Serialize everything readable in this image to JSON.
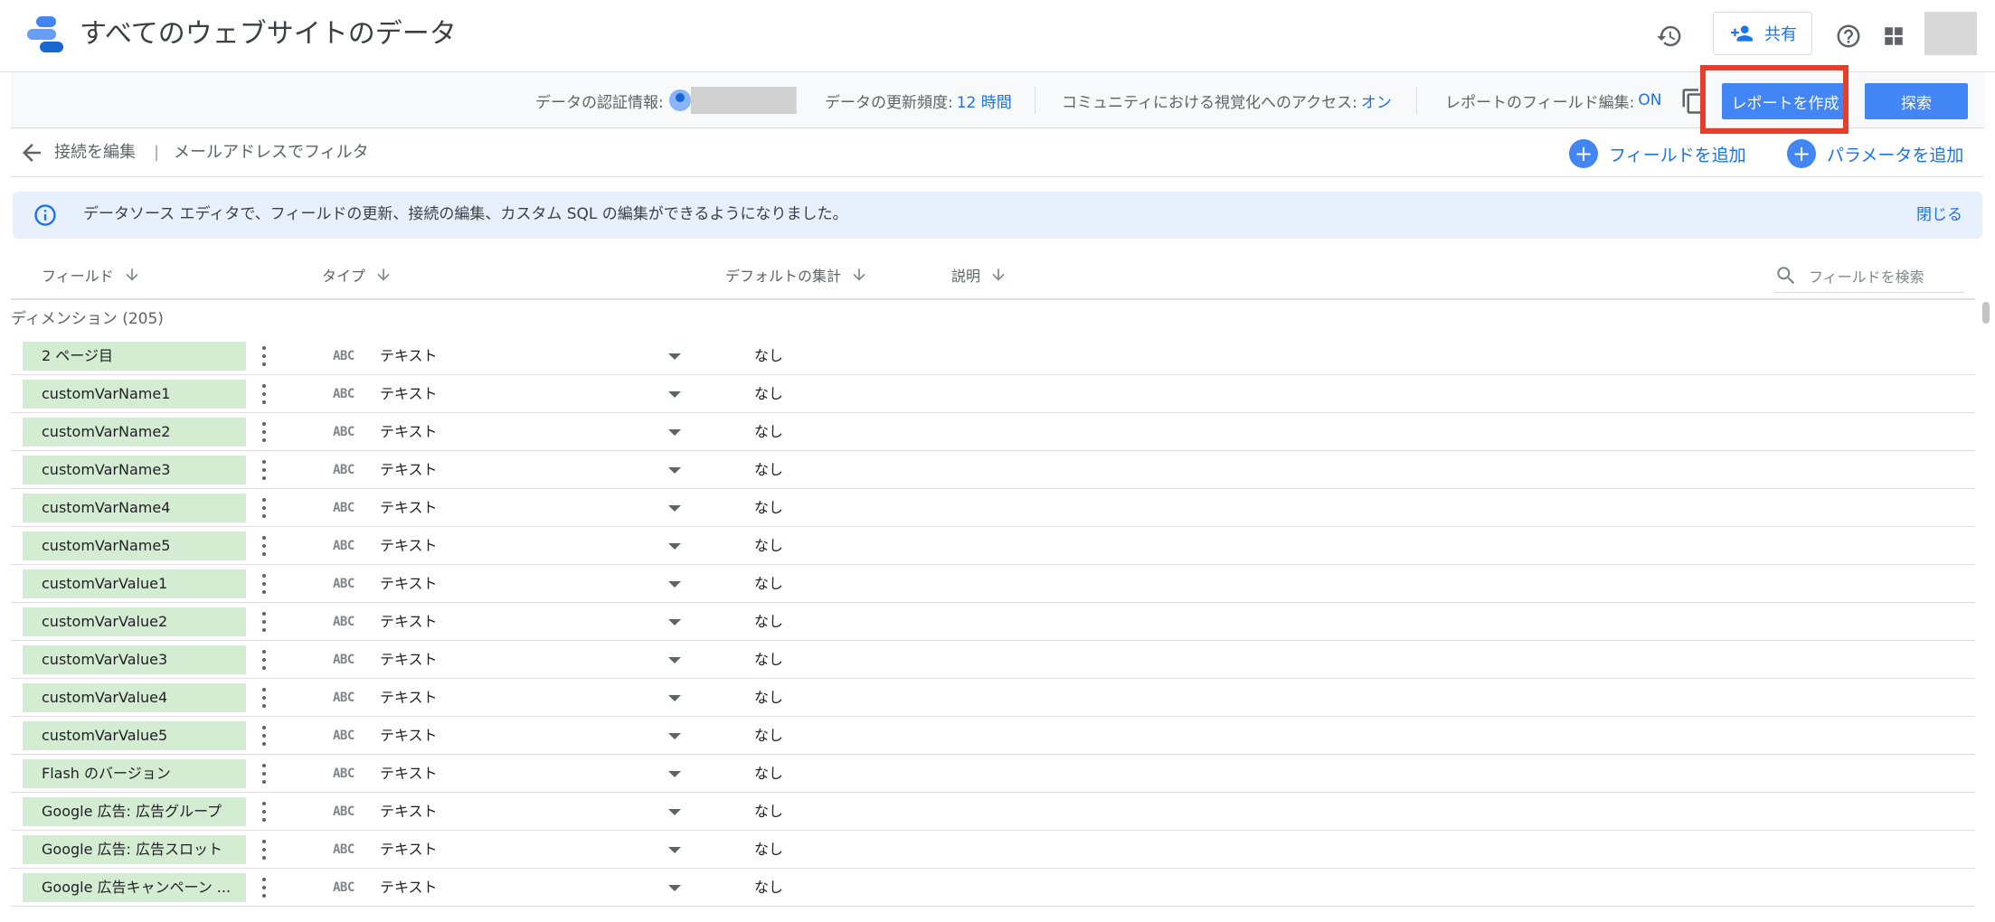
{
  "header": {
    "title": "すべてのウェブサイトのデータ",
    "share_label": "共有",
    "icons": [
      "history-icon",
      "person-add-icon",
      "help-icon",
      "apps-icon"
    ]
  },
  "toolbar": {
    "credentials_label": "データの認証情報:",
    "refresh_label": "データの更新頻度:",
    "refresh_value": "12 時間",
    "community_label": "コミュニティにおける視覚化へのアクセス:",
    "community_value": "オン",
    "field_edit_label": "レポートのフィールド編集:",
    "field_edit_value": "ON",
    "create_report_label": "レポートを作成",
    "explore_label": "探索"
  },
  "breadcrumb": {
    "edit_connection": "接続を編集",
    "separator": "|",
    "filter": "メールアドレスでフィルタ",
    "add_field": "フィールドを追加",
    "add_parameter": "パラメータを追加"
  },
  "banner": {
    "text": "データソース エディタで、フィールドの更新、接続の編集、カスタム SQL の編集ができるようになりました。",
    "close": "閉じる"
  },
  "columns": {
    "field": "フィールド",
    "type": "タイプ",
    "default_agg": "デフォルトの集計",
    "description": "説明",
    "search_placeholder": "フィールドを検索"
  },
  "section": {
    "title": "ディメンション (205)"
  },
  "type_icon_text": "ABC",
  "rows": [
    {
      "field": "2 ページ目",
      "type": "テキスト",
      "agg": "なし"
    },
    {
      "field": "customVarName1",
      "type": "テキスト",
      "agg": "なし"
    },
    {
      "field": "customVarName2",
      "type": "テキスト",
      "agg": "なし"
    },
    {
      "field": "customVarName3",
      "type": "テキスト",
      "agg": "なし"
    },
    {
      "field": "customVarName4",
      "type": "テキスト",
      "agg": "なし"
    },
    {
      "field": "customVarName5",
      "type": "テキスト",
      "agg": "なし"
    },
    {
      "field": "customVarValue1",
      "type": "テキスト",
      "agg": "なし"
    },
    {
      "field": "customVarValue2",
      "type": "テキスト",
      "agg": "なし"
    },
    {
      "field": "customVarValue3",
      "type": "テキスト",
      "agg": "なし"
    },
    {
      "field": "customVarValue4",
      "type": "テキスト",
      "agg": "なし"
    },
    {
      "field": "customVarValue5",
      "type": "テキスト",
      "agg": "なし"
    },
    {
      "field": "Flash のバージョン",
      "type": "テキスト",
      "agg": "なし"
    },
    {
      "field": "Google 広告: 広告グループ",
      "type": "テキスト",
      "agg": "なし"
    },
    {
      "field": "Google 広告: 広告スロット",
      "type": "テキスト",
      "agg": "なし"
    },
    {
      "field": "Google 広告キャンペーン ...",
      "type": "テキスト",
      "agg": "なし"
    }
  ],
  "colors": {
    "accent": "#4285f4",
    "link": "#1a73e8",
    "chip": "#d4ecd2",
    "highlight": "#e53e2b",
    "banner": "#e8f0fe"
  }
}
